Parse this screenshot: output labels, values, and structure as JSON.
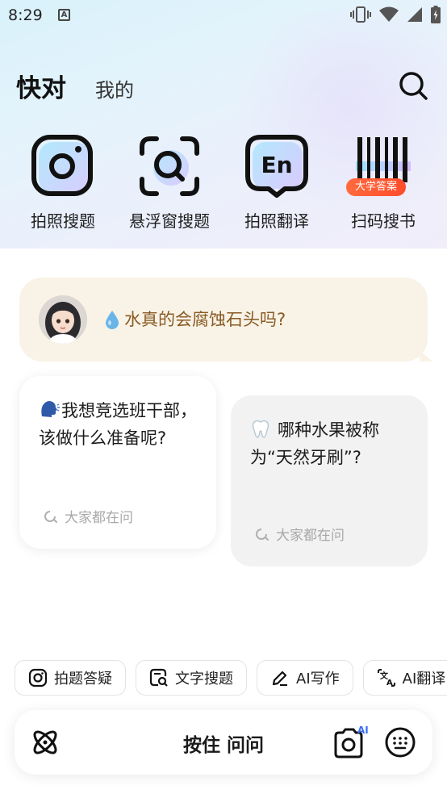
{
  "status": {
    "time": "8:29",
    "notification": "A"
  },
  "header": {
    "tabs": [
      {
        "label": "快对",
        "active": true
      },
      {
        "label": "我的",
        "active": false
      }
    ]
  },
  "tools": [
    {
      "label": "拍照搜题",
      "icon": "camera-icon"
    },
    {
      "label": "悬浮窗搜题",
      "icon": "float-search-icon"
    },
    {
      "label": "拍照翻译",
      "icon": "translate-en-icon"
    },
    {
      "label": "扫码搜书",
      "icon": "barcode-icon",
      "badge": "大学答案"
    }
  ],
  "question_banner": {
    "text": "水真的会腐蚀石头吗?"
  },
  "cards": [
    {
      "text": "我想竞选班干部，该做什么准备呢?",
      "meta": "大家都在问",
      "icon": "speaking-head-icon"
    },
    {
      "text": "哪种水果被称为“天然牙刷”?",
      "meta": "大家都在问",
      "icon": "tooth-icon"
    }
  ],
  "chips": [
    {
      "label": "拍题答疑",
      "icon": "camera-icon"
    },
    {
      "label": "文字搜题",
      "icon": "text-search-icon"
    },
    {
      "label": "AI写作",
      "icon": "pen-icon"
    },
    {
      "label": "AI翻译",
      "icon": "translate-icon"
    }
  ],
  "bottom_bar": {
    "voice_label": "按住 问问",
    "camera_badge": "AI"
  },
  "colors": {
    "accent_orange": "#ff5a2e",
    "banner_text": "#8a5a24",
    "banner_bg": "#f8f3e6"
  }
}
